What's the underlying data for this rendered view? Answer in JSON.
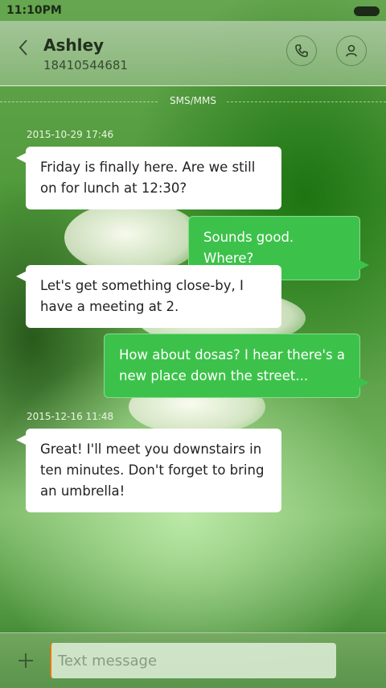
{
  "status_bar": {
    "time": "11:10PM"
  },
  "header": {
    "contact_name": "Ashley",
    "contact_number": "18410544681",
    "back_icon": "chevron-left-icon",
    "call_icon": "phone-icon",
    "profile_icon": "person-icon"
  },
  "thread": {
    "channel_label": "SMS/MMS",
    "timestamps": [
      "2015-10-29 17:46",
      "2015-12-16 11:48"
    ],
    "messages": [
      {
        "direction": "incoming",
        "text": "Friday is finally here. Are we still on for lunch at 12:30?"
      },
      {
        "direction": "outgoing",
        "text": "Sounds good. Where?"
      },
      {
        "direction": "incoming",
        "text": "Let's get something close-by, I have a meeting at 2."
      },
      {
        "direction": "outgoing",
        "text": "How about dosas? I hear there's a new place down the street..."
      },
      {
        "direction": "incoming",
        "text": "Great! I'll meet you downstairs in ten minutes. Don't forget to bring an umbrella!"
      }
    ]
  },
  "composer": {
    "placeholder": "Text message",
    "add_icon": "plus-icon"
  },
  "colors": {
    "outgoing_bubble": "#3cc24a",
    "incoming_bubble": "#ffffff",
    "accent_cursor": "#e07a10"
  }
}
